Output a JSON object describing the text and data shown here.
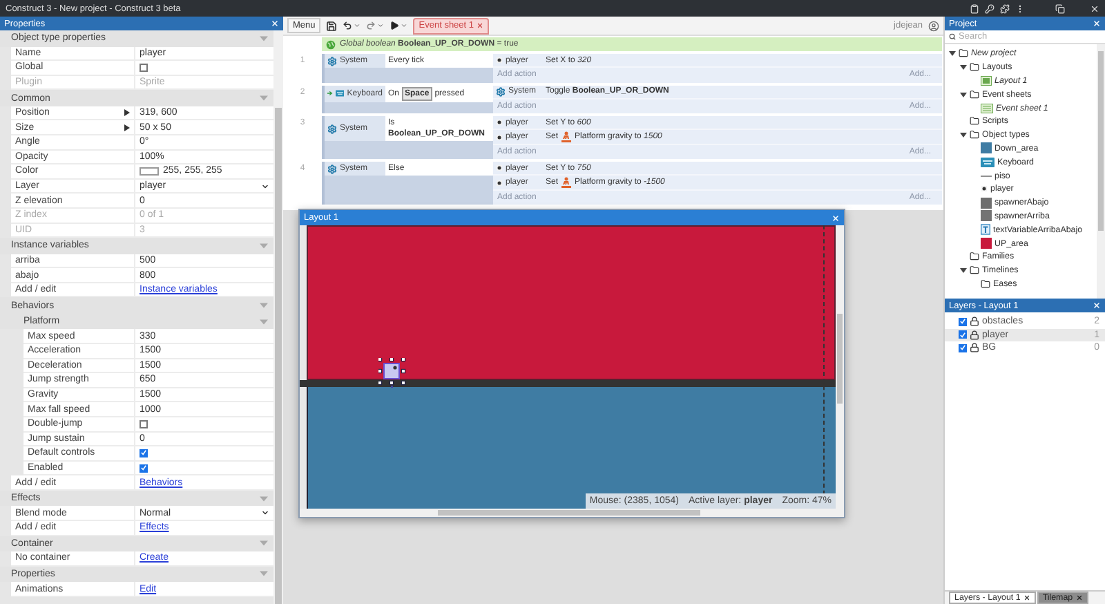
{
  "window": {
    "title": "Construct 3 - New project - Construct 3 beta"
  },
  "properties": {
    "title": "Properties",
    "sections": [
      {
        "title": "Object type properties",
        "rows": [
          {
            "label": "Name",
            "kind": "text",
            "value": "player",
            "disabled": false
          },
          {
            "label": "Global",
            "kind": "checkbox",
            "checked": false,
            "disabled": false
          },
          {
            "label": "Plugin",
            "kind": "text",
            "value": "Sprite",
            "disabled": true
          }
        ]
      },
      {
        "title": "Common",
        "rows": [
          {
            "label": "Position",
            "kind": "expand",
            "value": "319, 600",
            "disabled": false
          },
          {
            "label": "Size",
            "kind": "expand",
            "value": "50 x 50",
            "disabled": false
          },
          {
            "label": "Angle",
            "kind": "text",
            "value": "0°",
            "disabled": false
          },
          {
            "label": "Opacity",
            "kind": "text",
            "value": "100%",
            "disabled": false
          },
          {
            "label": "Color",
            "kind": "color",
            "value": "255, 255, 255",
            "disabled": false
          },
          {
            "label": "Layer",
            "kind": "dropdown",
            "value": "player",
            "disabled": false
          },
          {
            "label": "Z elevation",
            "kind": "text",
            "value": "0",
            "disabled": false
          },
          {
            "label": "Z index",
            "kind": "text",
            "value": "0 of 1",
            "disabled": true
          },
          {
            "label": "UID",
            "kind": "text",
            "value": "3",
            "disabled": true
          }
        ]
      },
      {
        "title": "Instance variables",
        "rows": [
          {
            "label": "arriba",
            "kind": "text",
            "value": "500",
            "disabled": false
          },
          {
            "label": "abajo",
            "kind": "text",
            "value": "800",
            "disabled": false
          },
          {
            "label": "Add / edit",
            "kind": "link",
            "value": "Instance variables"
          }
        ]
      },
      {
        "title": "Behaviors",
        "rows": [
          {
            "kind": "group",
            "title": "Platform",
            "rows": [
              {
                "label": "Max speed",
                "kind": "text",
                "value": "330",
                "disabled": false
              },
              {
                "label": "Acceleration",
                "kind": "text",
                "value": "1500",
                "disabled": false
              },
              {
                "label": "Deceleration",
                "kind": "text",
                "value": "1500",
                "disabled": false
              },
              {
                "label": "Jump strength",
                "kind": "text",
                "value": "650",
                "disabled": false
              },
              {
                "label": "Gravity",
                "kind": "text",
                "value": "1500",
                "disabled": false
              },
              {
                "label": "Max fall speed",
                "kind": "text",
                "value": "1000",
                "disabled": false
              },
              {
                "label": "Double-jump",
                "kind": "checkbox",
                "checked": false,
                "disabled": false
              },
              {
                "label": "Jump sustain",
                "kind": "text",
                "value": "0",
                "disabled": false
              },
              {
                "label": "Default controls",
                "kind": "checkbox",
                "checked": true,
                "disabled": false
              },
              {
                "label": "Enabled",
                "kind": "checkbox",
                "checked": true,
                "disabled": false
              }
            ]
          },
          {
            "label": "Add / edit",
            "kind": "link",
            "value": "Behaviors"
          }
        ]
      },
      {
        "title": "Effects",
        "rows": [
          {
            "label": "Blend mode",
            "kind": "dropdown",
            "value": "Normal",
            "disabled": false
          },
          {
            "label": "Add / edit",
            "kind": "link",
            "value": "Effects"
          }
        ]
      },
      {
        "title": "Container",
        "rows": [
          {
            "label": "No container",
            "kind": "link",
            "value": "Create"
          }
        ]
      },
      {
        "title": "Properties",
        "rows": [
          {
            "label": "Animations",
            "kind": "link",
            "value": "Edit"
          }
        ]
      }
    ]
  },
  "toolbar": {
    "menu": "Menu",
    "tabs": [
      {
        "label": "Event sheet 1",
        "selected": true
      }
    ],
    "user": "jdejean"
  },
  "event_sheet": {
    "global": "*Global boolean* **Boolean_UP_OR_DOWN** = true",
    "events": [
      {
        "number": "1",
        "trigger": false,
        "conditions": [
          {
            "object": {
              "kind": "system",
              "name": "System"
            },
            "kind": "plain",
            "text": "Every tick"
          }
        ],
        "actions": [
          {
            "object": {
              "kind": "sprite",
              "name": "player"
            },
            "kind": "plain",
            "text": "Set X to *320*"
          }
        ],
        "add_action": "Add action",
        "add_more": "Add..."
      },
      {
        "number": "2",
        "trigger": true,
        "conditions": [
          {
            "object": {
              "kind": "keyboard",
              "name": "Keyboard"
            },
            "kind": "key",
            "text": "On",
            "key": "Space",
            "suffix": "pressed"
          }
        ],
        "actions": [
          {
            "object": {
              "kind": "system",
              "name": "System"
            },
            "kind": "plain",
            "text": "Toggle **Boolean_UP_OR_DOWN**"
          }
        ],
        "add_action": "Add action",
        "add_more": "Add..."
      },
      {
        "number": "3",
        "trigger": false,
        "conditions": [
          {
            "object": {
              "kind": "system",
              "name": "System"
            },
            "kind": "plain",
            "text": "Is **Boolean_UP_OR_DOWN**"
          }
        ],
        "actions": [
          {
            "object": {
              "kind": "sprite",
              "name": "player"
            },
            "kind": "plain",
            "text": "Set Y to *600*"
          },
          {
            "object": {
              "kind": "sprite",
              "name": "player"
            },
            "kind": "behavior",
            "prefix": "Set",
            "text": "Platform gravity to *1500*"
          }
        ],
        "add_action": "Add action",
        "add_more": "Add..."
      },
      {
        "number": "4",
        "trigger": false,
        "conditions": [
          {
            "object": {
              "kind": "system",
              "name": "System"
            },
            "kind": "plain",
            "text": "Else"
          }
        ],
        "actions": [
          {
            "object": {
              "kind": "sprite",
              "name": "player"
            },
            "kind": "plain",
            "text": "Set Y to *750*"
          },
          {
            "object": {
              "kind": "sprite",
              "name": "player"
            },
            "kind": "behavior",
            "prefix": "Set",
            "text": "Platform gravity to *-1500*"
          }
        ],
        "add_action": "Add action",
        "add_more": "Add..."
      }
    ]
  },
  "layout_window": {
    "title": "Layout 1",
    "status": {
      "mouse": "Mouse: (2385, 1054)",
      "layer": "Active layer: **player**",
      "zoom": "Zoom: 47%"
    }
  },
  "project": {
    "title": "Project",
    "search_placeholder": "Search",
    "tree": [
      {
        "label": "New project",
        "kind": "folder",
        "expanded": true,
        "children": [
          {
            "label": "Layouts",
            "kind": "folder",
            "expanded": true,
            "children": [
              {
                "label": "Layout 1",
                "kind": "layout"
              }
            ]
          },
          {
            "label": "Event sheets",
            "kind": "folder",
            "expanded": true,
            "children": [
              {
                "label": "Event sheet 1",
                "kind": "eventsheet"
              }
            ]
          },
          {
            "label": "Scripts",
            "kind": "folder"
          },
          {
            "label": "Object types",
            "kind": "folder",
            "expanded": true,
            "children": [
              {
                "label": "Down_area",
                "kind": "swatch",
                "color": "#3f7ca3"
              },
              {
                "label": "Keyboard",
                "kind": "keyboard"
              },
              {
                "label": "piso",
                "kind": "line"
              },
              {
                "label": "player",
                "kind": "sprite"
              },
              {
                "label": "spawnerAbajo",
                "kind": "swatch",
                "color": "#6e6e6e"
              },
              {
                "label": "spawnerArriba",
                "kind": "swatch",
                "color": "#737373"
              },
              {
                "label": "textVariableArribaAbajo",
                "kind": "text"
              },
              {
                "label": "UP_area",
                "kind": "swatch",
                "color": "#c8193c"
              }
            ]
          },
          {
            "label": "Families",
            "kind": "folder"
          },
          {
            "label": "Timelines",
            "kind": "folder",
            "expanded": true,
            "children": [
              {
                "label": "Eases",
                "kind": "folder"
              }
            ]
          }
        ]
      }
    ]
  },
  "layers": {
    "title": "Layers - Layout 1",
    "items": [
      {
        "name": "obstacles",
        "number": "2",
        "visible": true,
        "selected": false
      },
      {
        "name": "player",
        "number": "1",
        "visible": true,
        "selected": true
      },
      {
        "name": "BG",
        "number": "0",
        "visible": true,
        "selected": false
      }
    ]
  },
  "bottom_tabs": [
    {
      "label": "Layers - Layout 1",
      "selected": true
    },
    {
      "label": "Tilemap",
      "selected": false
    }
  ]
}
